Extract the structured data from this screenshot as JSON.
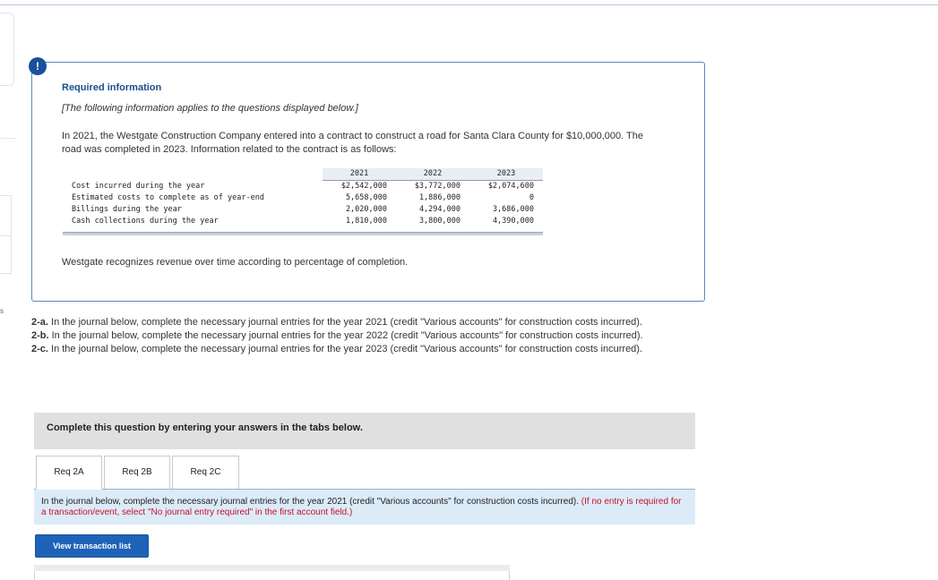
{
  "alert_icon": "!",
  "required_info": {
    "title": "Required information",
    "subtitle": "[The following information applies to the questions displayed below.]",
    "paragraph": "In 2021, the Westgate Construction Company entered into a contract to construct a road for Santa Clara County for $10,000,000. The road was completed in 2023. Information related to the contract is as follows:",
    "revenue_note": "Westgate recognizes revenue over time according to percentage of completion."
  },
  "contract_table": {
    "years": [
      "2021",
      "2022",
      "2023"
    ],
    "rows": [
      {
        "label": "Cost incurred during the year",
        "values": [
          "$2,542,000",
          "$3,772,000",
          "$2,074,600"
        ]
      },
      {
        "label": "Estimated costs to complete as of year-end",
        "values": [
          "5,658,000",
          "1,886,000",
          "0"
        ]
      },
      {
        "label": "Billings during the year",
        "values": [
          "2,020,000",
          "4,294,000",
          "3,686,000"
        ]
      },
      {
        "label": "Cash collections during the year",
        "values": [
          "1,810,000",
          "3,800,000",
          "4,390,000"
        ]
      }
    ]
  },
  "instructions": [
    {
      "label": "2-a.",
      "text": " In the journal below, complete the necessary journal entries for the year 2021 (credit \"Various accounts\" for construction costs incurred)."
    },
    {
      "label": "2-b.",
      "text": " In the journal below, complete the necessary journal entries for the year 2022 (credit \"Various accounts\" for construction costs incurred)."
    },
    {
      "label": "2-c.",
      "text": " In the journal below, complete the necessary journal entries for the year 2023 (credit \"Various accounts\" for construction costs incurred)."
    }
  ],
  "question_bar": "Complete this question by entering your answers in the tabs below.",
  "tabs": [
    "Req 2A",
    "Req 2B",
    "Req 2C"
  ],
  "tab_panel": {
    "text": "In the journal below, complete the necessary journal entries for the year 2021 (credit \"Various accounts\" for construction costs incurred). ",
    "note": "(If no entry is required for a transaction/event, select \"No journal entry required\" in the first account field.)"
  },
  "view_button": "View transaction list",
  "rail_letter": "s",
  "colors": {
    "accent_blue": "#1f63b8",
    "title_blue": "#1a4f8f",
    "box_border": "#5b86c1",
    "panel_bg": "#dcebf8",
    "note_red": "#c8102e"
  }
}
